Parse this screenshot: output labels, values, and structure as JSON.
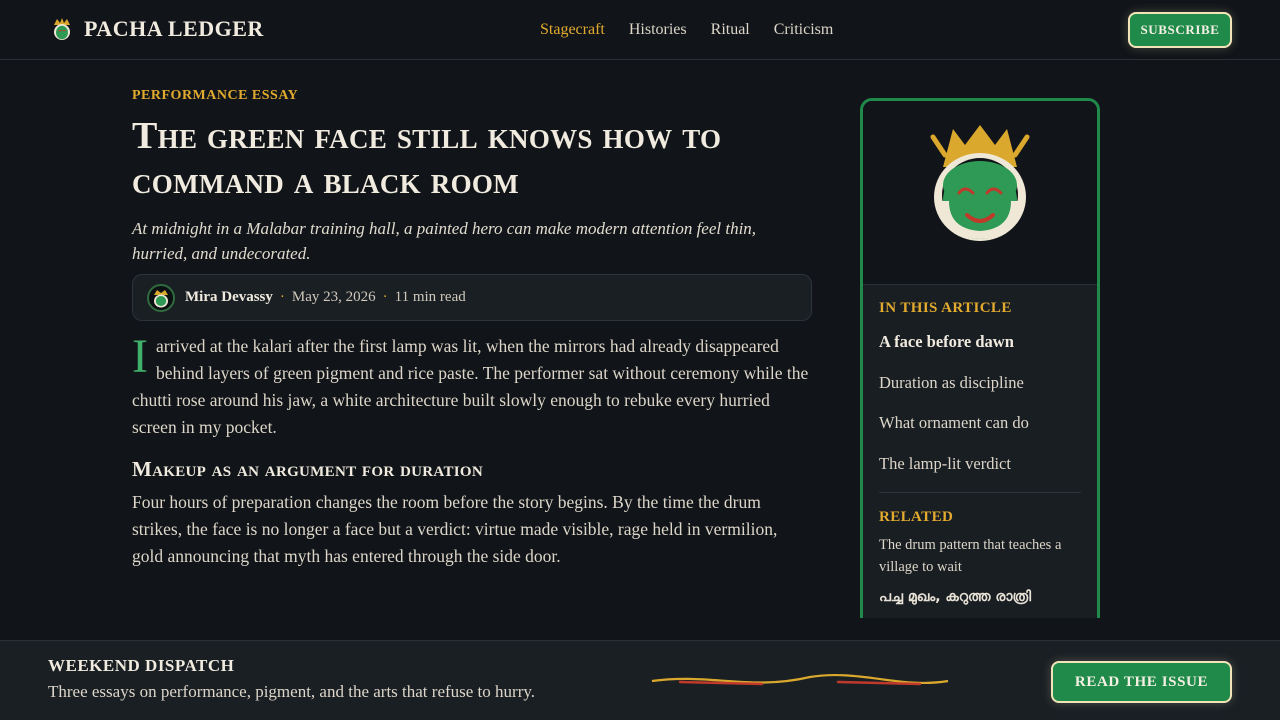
{
  "header": {
    "brand": "PACHA LEDGER",
    "nav": [
      {
        "label": "Stagecraft",
        "active": true
      },
      {
        "label": "Histories",
        "active": false
      },
      {
        "label": "Ritual",
        "active": false
      },
      {
        "label": "Criticism",
        "active": false
      }
    ],
    "subscribe_label": "SUBSCRIBE"
  },
  "article": {
    "kicker": "PERFORMANCE ESSAY",
    "headline": "The green face still knows how to command a black room",
    "dek": "At midnight in a Malabar training hall, a painted hero can make modern attention feel thin, hurried, and undecorated.",
    "byline": {
      "author": "Mira Devassy",
      "date": "May 23, 2026",
      "read_time": "11 min read"
    },
    "dropcap": "I",
    "lede": "arrived at the kalari after the first lamp was lit, when the mirrors had already disappeared behind layers of green pigment and rice paste. The performer sat without ceremony while the chutti rose around his jaw, a white architecture built slowly enough to rebuke every hurried screen in my pocket.",
    "section_heading": "Makeup as an argument for duration",
    "paragraph2": "Four hours of preparation changes the room before the story begins. By the time the drum strikes, the face is no longer a face but a verdict: virtue made visible, rage held in vermilion, gold announcing that myth has entered through the side door."
  },
  "sidebar": {
    "toc_label": "IN THIS ARTICLE",
    "toc": [
      "A face before dawn",
      "Duration as discipline",
      "What ornament can do",
      "The lamp-lit verdict"
    ],
    "related_label": "RELATED",
    "related": [
      "The drum pattern that teaches a village to wait",
      "പച്ച മുഖം, കറുത്ത രാത്രി"
    ]
  },
  "dispatch": {
    "title": "WEEKEND DISPATCH",
    "text": "Three essays on performance, pigment, and the arts that refuse to hurry.",
    "button_label": "READ THE ISSUE"
  },
  "colors": {
    "background": "#111519",
    "accent_gold": "#e2aa2e",
    "accent_green": "#1f8a4a",
    "text": "#e8e2d6"
  }
}
